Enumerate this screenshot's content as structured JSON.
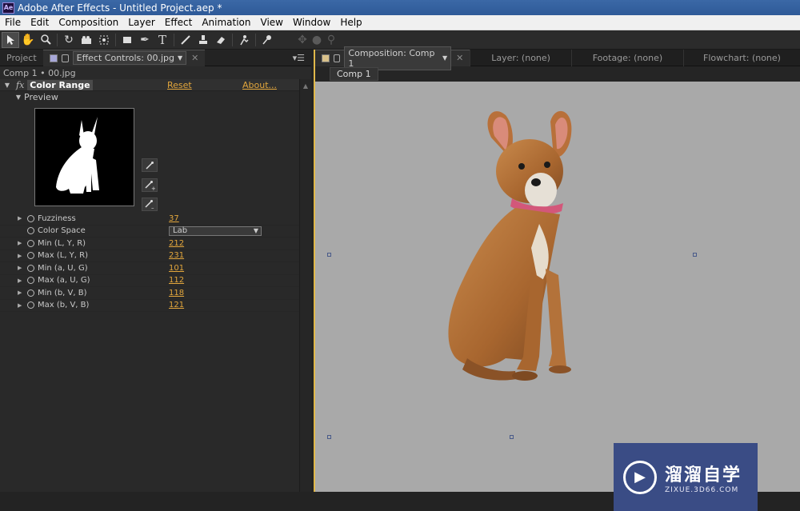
{
  "app": {
    "title": "Adobe After Effects - Untitled Project.aep *",
    "icon": "Ae"
  },
  "menu": [
    "File",
    "Edit",
    "Composition",
    "Layer",
    "Effect",
    "Animation",
    "View",
    "Window",
    "Help"
  ],
  "toolbar": {
    "tools": [
      "selection-tool-icon",
      "hand-tool-icon",
      "zoom-tool-icon",
      "rotate-tool-icon",
      "camera-tool-icon",
      "pan-behind-tool-icon",
      "rectangle-tool-icon",
      "pen-tool-icon",
      "text-tool-icon",
      "brush-tool-icon",
      "clone-stamp-tool-icon",
      "eraser-tool-icon",
      "roto-brush-tool-icon",
      "puppet-pin-tool-icon"
    ],
    "text_tool_glyph": "T"
  },
  "left_panel": {
    "tab_project": "Project",
    "tab_effect_controls": "Effect Controls: 00.jpg",
    "breadcrumb": "Comp 1 • 00.jpg",
    "effect": {
      "fx": "fx",
      "name": "Color Range",
      "reset": "Reset",
      "about": "About...",
      "preview_label": "Preview"
    },
    "properties": [
      {
        "name": "Fuzziness",
        "value": "37"
      },
      {
        "name": "Color Space",
        "value": "Lab"
      },
      {
        "name": "Min (L, Y, R)",
        "value": "212"
      },
      {
        "name": "Max (L, Y, R)",
        "value": "231"
      },
      {
        "name": "Min (a, U, G)",
        "value": "101"
      },
      {
        "name": "Max (a, U, G)",
        "value": "112"
      },
      {
        "name": "Min (b, V, B)",
        "value": "118"
      },
      {
        "name": "Max (b, V, B)",
        "value": "121"
      }
    ]
  },
  "right_panel": {
    "tab_composition": "Composition: Comp 1",
    "tab_layer": "Layer: (none)",
    "tab_footage": "Footage: (none)",
    "tab_flowchart": "Flowchart: (none)",
    "sub_tab": "Comp 1"
  },
  "watermark": {
    "chinese": "溜溜自学",
    "url": "ZIXUE.3D66.COM"
  }
}
